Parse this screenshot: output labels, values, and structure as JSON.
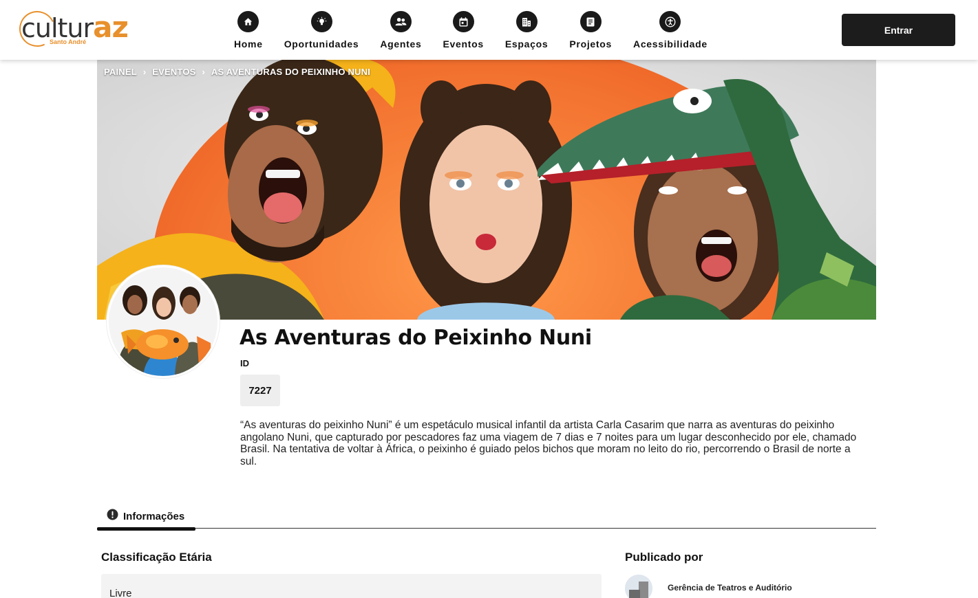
{
  "header": {
    "logo": {
      "main": "cultur",
      "accent": "az",
      "sub": "Santo André"
    },
    "nav": [
      {
        "label": "Home",
        "icon": "home-icon"
      },
      {
        "label": "Oportunidades",
        "icon": "lightbulb-icon"
      },
      {
        "label": "Agentes",
        "icon": "users-icon"
      },
      {
        "label": "Eventos",
        "icon": "calendar-icon"
      },
      {
        "label": "Espaços",
        "icon": "building-icon"
      },
      {
        "label": "Projetos",
        "icon": "clipboard-icon"
      },
      {
        "label": "Acessibilidade",
        "icon": "accessibility-icon"
      }
    ],
    "login_label": "Entrar"
  },
  "breadcrumb": [
    "PAINEL",
    "EVENTOS",
    "AS AVENTURAS DO PEIXINHO NUNI"
  ],
  "event": {
    "title": "As Aventuras do Peixinho Nuni",
    "id_label": "ID",
    "id_value": "7227",
    "description": "“As aventuras do peixinho Nuni” é um espetáculo musical infantil da artista Carla Casarim que narra as aventuras do peixinho angolano Nuni, que capturado por pescadores faz uma viagem de 7 dias e 7 noites para um lugar desconhecido por ele, chamado Brasil. Na tentativa de voltar à África, o peixinho é guiado pelos bichos que moram no leito do rio, percorrendo o Brasil de norte a sul."
  },
  "tabs": [
    {
      "label": "Informações",
      "icon": "info-icon"
    }
  ],
  "sections": {
    "classification_title": "Classificação Etária",
    "classification_value": "Livre",
    "published_title": "Publicado por",
    "publisher_name": "Gerência de Teatros e Auditório"
  },
  "colors": {
    "brand_orange": "#e8902c",
    "dark": "#1c1c1c"
  }
}
